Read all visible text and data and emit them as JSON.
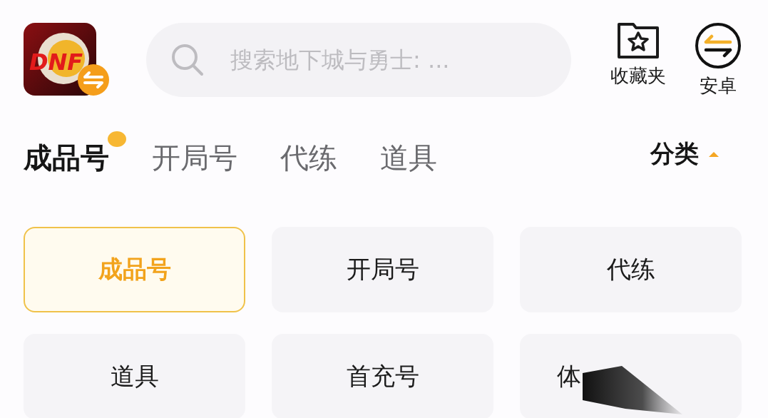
{
  "app_logo": {
    "text": "DNF"
  },
  "search": {
    "placeholder": "搜索地下城与勇士: ..."
  },
  "header_actions": [
    {
      "kind": "favorites",
      "label": "收藏夹"
    },
    {
      "kind": "platform",
      "label": "安卓"
    }
  ],
  "tabs": [
    {
      "label": "成品号",
      "selected": true
    },
    {
      "label": "开局号",
      "selected": false
    },
    {
      "label": "代练",
      "selected": false
    },
    {
      "label": "道具",
      "selected": false
    }
  ],
  "category_toggle": {
    "label": "分类",
    "expanded": true
  },
  "categories": [
    {
      "kind": "plain",
      "label": "成品号",
      "selected": true
    },
    {
      "kind": "plain",
      "label": "开局号",
      "selected": false
    },
    {
      "kind": "plain",
      "label": "代练",
      "selected": false
    },
    {
      "kind": "plain",
      "label": "道具",
      "selected": false
    },
    {
      "kind": "plain",
      "label": "首充号",
      "selected": false
    },
    {
      "kind": "smeared",
      "label": "体",
      "selected": false
    }
  ]
}
